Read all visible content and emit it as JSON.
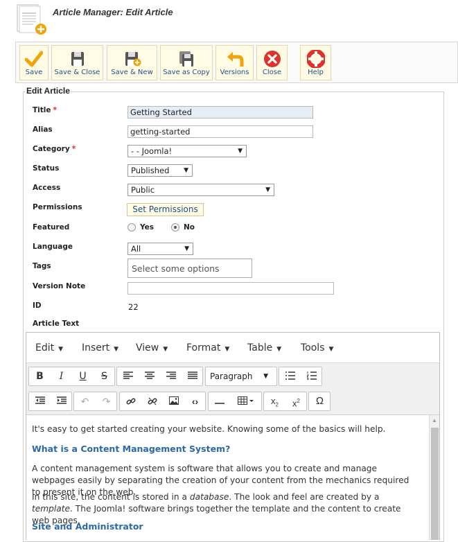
{
  "header": {
    "title": "Article Manager: Edit Article",
    "icon": "article-add-icon"
  },
  "toolbar": {
    "buttons": [
      {
        "label": "Save",
        "icon": "checkmark-icon",
        "color": "#f0a30a"
      },
      {
        "label": "Save & Close",
        "icon": "floppy-disk-icon",
        "color": "#555555"
      },
      {
        "label": "Save & New",
        "icon": "floppy-plus-icon",
        "color": "#555555"
      },
      {
        "label": "Save as Copy",
        "icon": "copy-icon",
        "color": "#555555"
      },
      {
        "label": "Versions",
        "icon": "undo-arrow-icon",
        "color": "#f0a30a"
      },
      {
        "label": "Close",
        "icon": "close-circle-icon",
        "color": "#e0322d"
      },
      {
        "label": "Help",
        "icon": "lifebuoy-icon",
        "color": "#e0322d"
      }
    ]
  },
  "form": {
    "legend": "Edit Article",
    "title_label": "Title",
    "title_value": "Getting Started",
    "alias_label": "Alias",
    "alias_value": "getting-started",
    "category_label": "Category",
    "category_value": "- - Joomla!",
    "status_label": "Status",
    "status_value": "Published",
    "access_label": "Access",
    "access_value": "Public",
    "permissions_label": "Permissions",
    "permissions_button": "Set Permissions",
    "featured_label": "Featured",
    "featured_yes": "Yes",
    "featured_no": "No",
    "featured_selected": "No",
    "language_label": "Language",
    "language_value": "All",
    "tags_label": "Tags",
    "tags_placeholder": "Select some options",
    "version_note_label": "Version Note",
    "version_note_value": "",
    "id_label": "ID",
    "id_value": "22",
    "article_text_label": "Article Text",
    "required_mark": "*"
  },
  "editor": {
    "menus": [
      "Edit",
      "Insert",
      "View",
      "Format",
      "Table",
      "Tools"
    ],
    "format_select": "Paragraph",
    "content": {
      "p1": "It's easy to get started creating your website. Knowing some of the basics will help.",
      "h1": "What is a Content Management System?",
      "p2": "A content management system is software that allows you to create and manage webpages easily by separating the creation of your content from the mechanics required to present it on the web.",
      "p3_a": "In this site, the content is stored in a ",
      "p3_b": "database",
      "p3_c": ". The look and feel are created by a ",
      "p3_d": "template",
      "p3_e": ". The Joomla! software brings together the template and the content to create web pages.",
      "h2": "Site and Administrator"
    }
  }
}
